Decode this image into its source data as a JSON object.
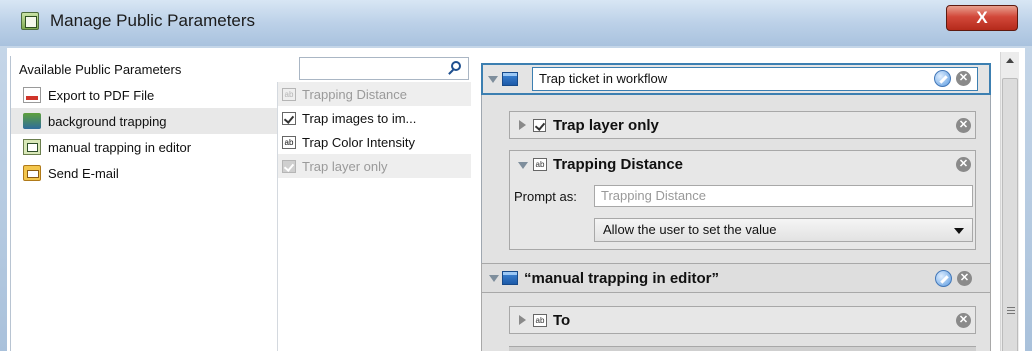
{
  "window": {
    "title": "Manage Public Parameters",
    "close_glyph": "X"
  },
  "left": {
    "header_label": "Available Public Parameters",
    "search": {
      "value": "",
      "icon": "search-icon"
    },
    "items": [
      {
        "label": "Export to PDF File",
        "icon": "pdf-icon",
        "selected": false
      },
      {
        "label": "background trapping",
        "icon": "trapping-icon",
        "selected": true
      },
      {
        "label": "manual trapping in editor",
        "icon": "editor-icon",
        "selected": false
      },
      {
        "label": "Send E-mail",
        "icon": "mail-icon",
        "selected": false
      }
    ],
    "sub_items": [
      {
        "label": "Trapping Distance",
        "icon": "ab",
        "disabled": true
      },
      {
        "label": "Trap images to im...",
        "icon": "check",
        "disabled": false
      },
      {
        "label": "Trap Color Intensity",
        "icon": "ab",
        "disabled": false
      },
      {
        "label": "Trap layer only",
        "icon": "check",
        "disabled": true
      }
    ]
  },
  "right": {
    "group1": {
      "input_value": "Trap ticket in workflow"
    },
    "group1_child1": {
      "label": "Trap layer only"
    },
    "group1_child2": {
      "label": "Trapping Distance",
      "ab_glyph": "ab",
      "prompt_label": "Prompt as:",
      "prompt_placeholder": "Trapping Distance",
      "select_value": "Allow the user to set the value"
    },
    "group2": {
      "label": "“manual trapping in editor”"
    },
    "group2_child1": {
      "label": "To",
      "ab_glyph": "ab"
    },
    "x_glyph": "✕"
  },
  "colors": {
    "accent": "#3c7fb1",
    "close_button": "#c53a2a"
  }
}
